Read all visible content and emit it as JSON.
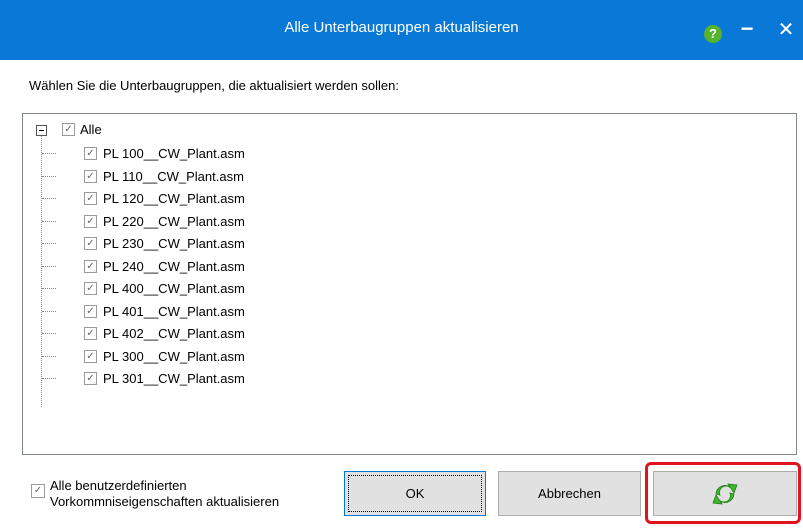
{
  "dialog": {
    "title": "Alle Unterbaugruppen aktualisieren",
    "help_icon": "help-icon",
    "help_glyph": "?",
    "minimize_glyph": "−",
    "close_glyph": "✕"
  },
  "instruction": "Wählen Sie die Unterbaugruppen, die aktualisiert werden sollen:",
  "tree": {
    "root": {
      "label": "Alle",
      "checked": true,
      "expanded": true
    },
    "items": [
      {
        "label": "PL 100__CW_Plant.asm",
        "checked": true
      },
      {
        "label": "PL 110__CW_Plant.asm",
        "checked": true
      },
      {
        "label": "PL 120__CW_Plant.asm",
        "checked": true
      },
      {
        "label": "PL 220__CW_Plant.asm",
        "checked": true
      },
      {
        "label": "PL 230__CW_Plant.asm",
        "checked": true
      },
      {
        "label": "PL 240__CW_Plant.asm",
        "checked": true
      },
      {
        "label": "PL 400__CW_Plant.asm",
        "checked": true
      },
      {
        "label": "PL 401__CW_Plant.asm",
        "checked": true
      },
      {
        "label": "PL 402__CW_Plant.asm",
        "checked": true
      },
      {
        "label": "PL 300__CW_Plant.asm",
        "checked": true
      },
      {
        "label": "PL 301__CW_Plant.asm",
        "checked": true
      }
    ]
  },
  "options": {
    "update_custom_props_line1": "Alle benutzerdefinierten",
    "update_custom_props_line2": "Vorkommniseigenschaften aktualisieren",
    "update_custom_props_checked": true
  },
  "buttons": {
    "ok": "OK",
    "cancel": "Abbrechen",
    "update_icon": "refresh-arrows-icon"
  },
  "colors": {
    "titlebar": "#0a78d7",
    "highlight": "#e0141e",
    "refresh_green": "#3cb82c"
  }
}
